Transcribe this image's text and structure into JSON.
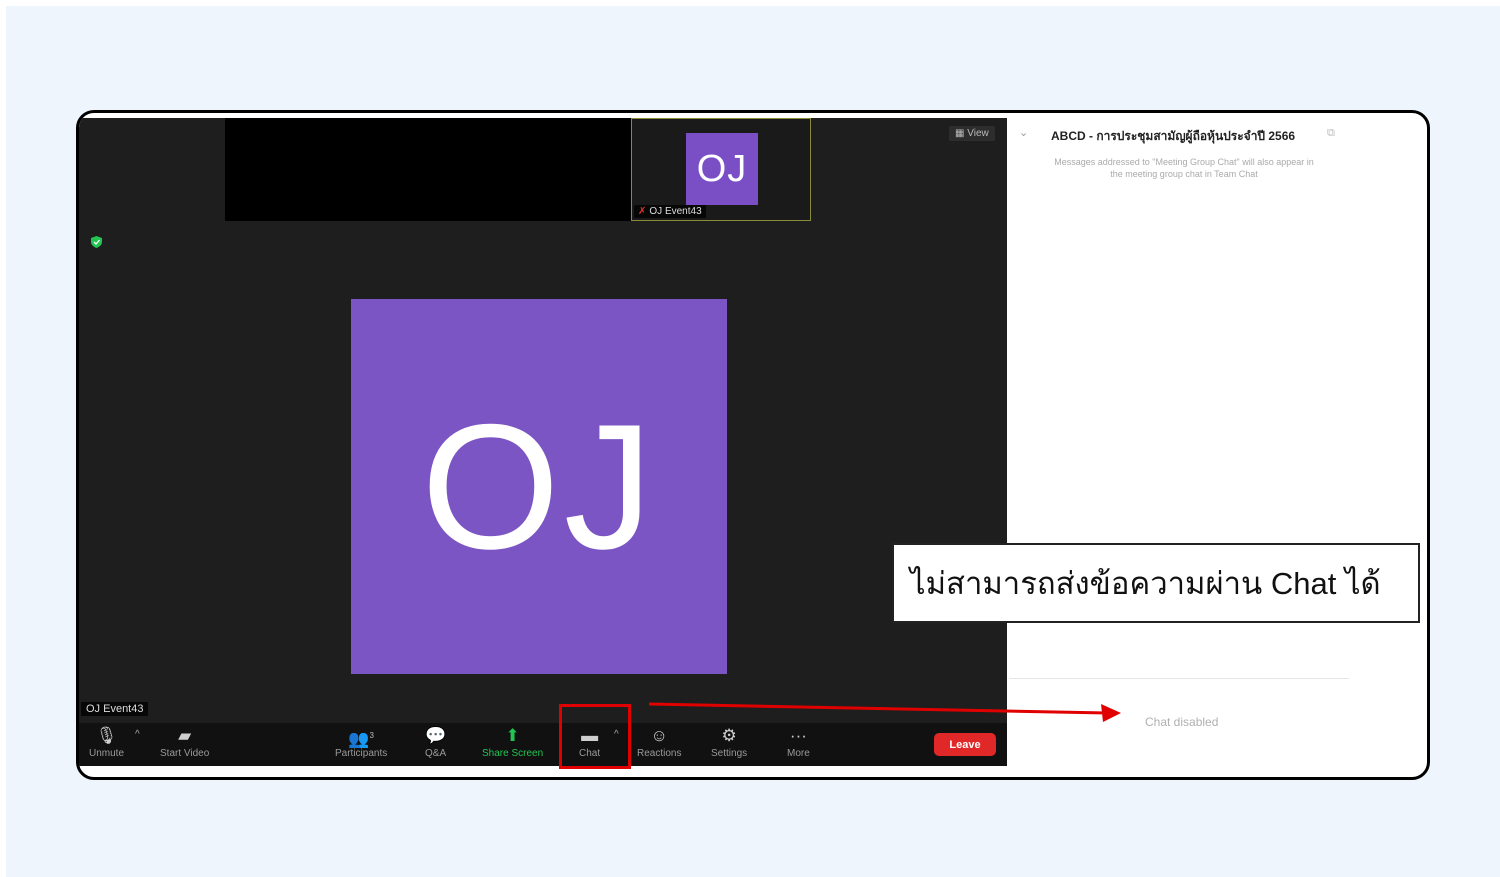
{
  "meeting": {
    "view_label": "View",
    "thumbnail": {
      "initials": "OJ",
      "name": "OJ Event43"
    },
    "main_video": {
      "initials": "OJ",
      "name": "OJ Event43"
    }
  },
  "toolbar": {
    "unmute": "Unmute",
    "start_video": "Start Video",
    "participants": "Participants",
    "participants_count": "3",
    "qa": "Q&A",
    "share_screen": "Share Screen",
    "chat": "Chat",
    "reactions": "Reactions",
    "settings": "Settings",
    "more": "More",
    "leave": "Leave"
  },
  "chat_panel": {
    "title": "ABCD - การประชุมสามัญผู้ถือหุ้นประจำปี 2566",
    "note": "Messages addressed to \"Meeting Group Chat\" will also appear in the meeting group chat in Team Chat",
    "status": "Chat disabled"
  },
  "callout": {
    "text": "ไม่สามารถส่งข้อความผ่าน Chat ได้"
  },
  "colors": {
    "avatar": "#7c55c4",
    "leave": "#e02828",
    "highlight": "#e00000",
    "share_green": "#23c552"
  },
  "icons": [
    "microphone-muted-icon",
    "video-off-icon",
    "participants-icon",
    "qa-icon",
    "share-screen-icon",
    "chat-icon",
    "reactions-icon",
    "gear-icon",
    "more-icon",
    "shield-icon",
    "popout-icon",
    "chevron-down-icon"
  ]
}
